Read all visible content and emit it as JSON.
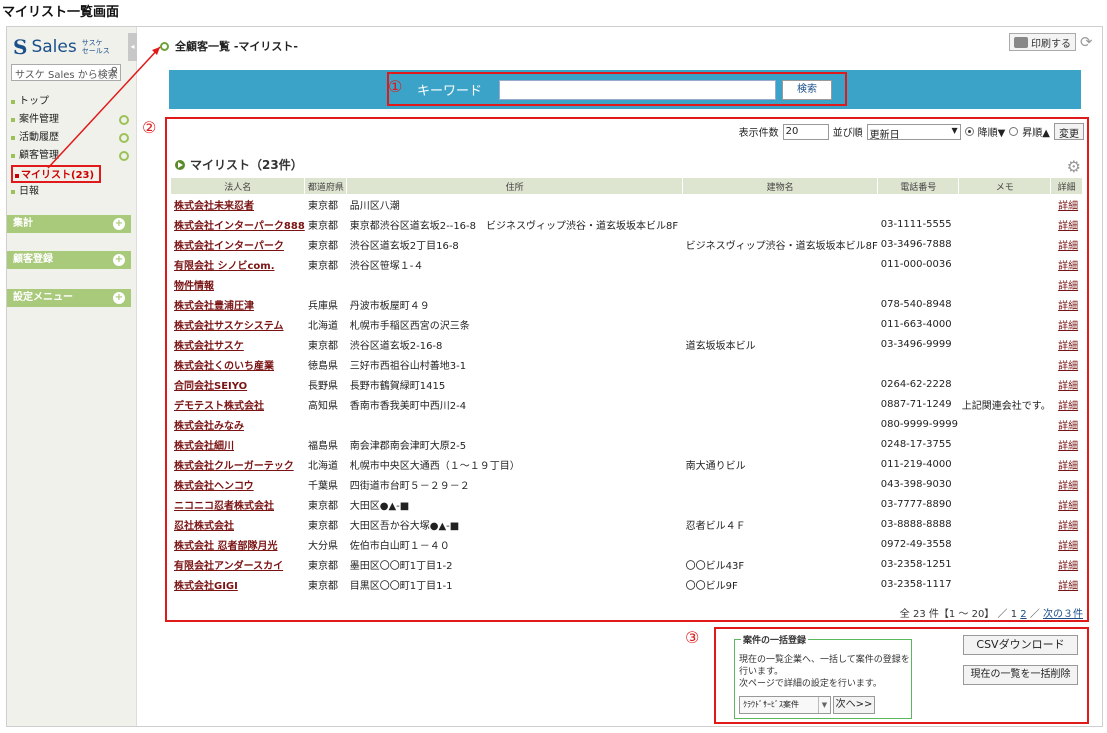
{
  "page_caption": "マイリスト一覧画面",
  "sidebar": {
    "logo_text": "Sales",
    "logo_sub_1": "サスケ",
    "logo_sub_2": "セールス",
    "search_placeholder": "サスケ Sales から検索",
    "nav": [
      {
        "label": "トップ",
        "plus": false,
        "active": false
      },
      {
        "label": "案件管理",
        "plus": true,
        "active": false
      },
      {
        "label": "活動履歴",
        "plus": true,
        "active": false
      },
      {
        "label": "顧客管理",
        "plus": true,
        "active": false
      },
      {
        "label": "マイリスト(23)",
        "plus": false,
        "active": true
      },
      {
        "label": "日報",
        "plus": false,
        "active": false
      }
    ],
    "sections": [
      "集計",
      "顧客登録",
      "設定メニュー"
    ],
    "plus_glyph": "+"
  },
  "breadcrumb": "全顧客一覧 -マイリスト-",
  "toolbar": {
    "print_label": "印刷する",
    "refresh_icon": "refresh-icon"
  },
  "search": {
    "marker": "①",
    "label": "キーワード",
    "value": "",
    "button": "検索"
  },
  "list": {
    "marker": "②",
    "display_count_label": "表示件数",
    "display_count_value": "20",
    "sort_label": "並び順",
    "sort_value": "更新日",
    "desc_label": "降順▼",
    "asc_label": "昇順▲",
    "change_button": "変更",
    "title": "マイリスト（23件）",
    "columns": [
      "法人名",
      "都道府県",
      "住所",
      "建物名",
      "電話番号",
      "メモ",
      "詳細"
    ],
    "rows": [
      [
        "株式会社未来忍者",
        "東京都",
        "品川区八潮",
        "",
        "",
        "",
        "詳細"
      ],
      [
        "株式会社インターパーク888",
        "東京都",
        "東京都渋谷区道玄坂2--16-8　ビジネスヴィップ渋谷・道玄坂坂本ビル8F",
        "",
        "03-1111-5555",
        "",
        "詳細"
      ],
      [
        "株式会社インターパーク",
        "東京都",
        "渋谷区道玄坂2丁目16-8",
        "ビジネスヴィップ渋谷・道玄坂坂本ビル8F",
        "03-3496-7888",
        "",
        "詳細"
      ],
      [
        "有限会社 シノビcom.",
        "東京都",
        "渋谷区笹塚１-４",
        "",
        "011-000-0036",
        "",
        "詳細"
      ],
      [
        "物件情報",
        "",
        "",
        "",
        "",
        "",
        "詳細"
      ],
      [
        "株式会社豊浦圧津",
        "兵庫県",
        "丹波市板屋町４９",
        "",
        "078-540-8948",
        "",
        "詳細"
      ],
      [
        "株式会社サスケシステム",
        "北海道",
        "札幌市手稲区西宮の沢三条",
        "",
        "011-663-4000",
        "",
        "詳細"
      ],
      [
        "株式会社サスケ",
        "東京都",
        "渋谷区道玄坂2-16-8",
        "道玄坂坂本ビル",
        "03-3496-9999",
        "",
        "詳細"
      ],
      [
        "株式会社くのいち産業",
        "徳島県",
        "三好市西祖谷山村善地3-1",
        "",
        "",
        "",
        "詳細"
      ],
      [
        "合同会社SEIYO",
        "長野県",
        "長野市鶴賀緑町1415",
        "",
        "0264-62-2228",
        "",
        "詳細"
      ],
      [
        "デモテスト株式会社",
        "高知県",
        "香南市香我美町中西川2-4",
        "",
        "0887-71-1249",
        "上記関連会社です。",
        "詳細"
      ],
      [
        "株式会社みなみ",
        "",
        "",
        "",
        "080-9999-9999",
        "",
        "詳細"
      ],
      [
        "株式会社細川",
        "福島県",
        "南会津郡南会津町大原2-5",
        "",
        "0248-17-3755",
        "",
        "詳細"
      ],
      [
        "株式会社クルーガーテック",
        "北海道",
        "札幌市中央区大通西（１～１９丁目）",
        "南大通りビル",
        "011-219-4000",
        "",
        "詳細"
      ],
      [
        "株式会社ヘンコウ",
        "千葉県",
        "四街道市台町５－２９－２",
        "",
        "043-398-9030",
        "",
        "詳細"
      ],
      [
        "ニコニコ忍者株式会社",
        "東京都",
        "大田区●▲-■",
        "",
        "03-7777-8890",
        "",
        "詳細"
      ],
      [
        "忍社株式会社",
        "東京都",
        "大田区吾か谷大塚●▲-■",
        "忍者ビル４Ｆ",
        "03-8888-8888",
        "",
        "詳細"
      ],
      [
        "株式会社 忍者部隊月光",
        "大分県",
        "佐伯市白山町１－４０",
        "",
        "0972-49-3558",
        "",
        "詳細"
      ],
      [
        "有限会社アンダースカイ",
        "東京都",
        "墨田区〇〇町1丁目1-2",
        "〇〇ビル43F",
        "03-2358-1251",
        "",
        "詳細"
      ],
      [
        "株式会社GIGI",
        "東京都",
        "目黒区〇〇町1丁目1-1",
        "〇〇ビル9F",
        "03-2358-1117",
        "",
        "詳細"
      ]
    ],
    "pager_summary": "全 23 件【1 ～ 20】 ／",
    "pager_page1": "1",
    "pager_page2": "2",
    "pager_sep": "／",
    "pager_next": "次の３件"
  },
  "bulk": {
    "marker": "③",
    "legend": "案件の一括登録",
    "text_1": "現在の一覧企業へ、一括して案件の登録を行います。",
    "text_2": "次ページで詳細の設定を行います。",
    "select_value": "ｸﾗｳﾄﾞｻｰﾋﾞｽ案件",
    "next_button": "次へ>>",
    "csv_button": "CSVダウンロード",
    "delete_button": "現在の一覧を一括削除"
  },
  "colors": {
    "accent_red": "#e01a1a",
    "banner_blue": "#3ca3c8",
    "sidebar_green": "#a9c97b",
    "link_maroon": "#7a1414"
  }
}
